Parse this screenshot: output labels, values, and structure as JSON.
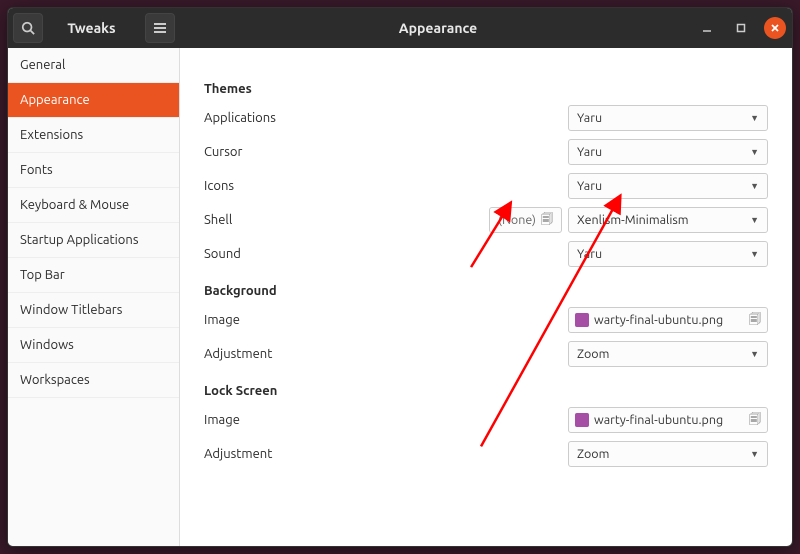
{
  "titlebar": {
    "app_name": "Tweaks",
    "page_title": "Appearance"
  },
  "sidebar": {
    "items": [
      {
        "label": "General"
      },
      {
        "label": "Appearance"
      },
      {
        "label": "Extensions"
      },
      {
        "label": "Fonts"
      },
      {
        "label": "Keyboard & Mouse"
      },
      {
        "label": "Startup Applications"
      },
      {
        "label": "Top Bar"
      },
      {
        "label": "Window Titlebars"
      },
      {
        "label": "Windows"
      },
      {
        "label": "Workspaces"
      }
    ],
    "active_index": 1
  },
  "sections": {
    "themes": {
      "title": "Themes",
      "rows": {
        "applications": {
          "label": "Applications",
          "value": "Yaru"
        },
        "cursor": {
          "label": "Cursor",
          "value": "Yaru"
        },
        "icons": {
          "label": "Icons",
          "value": "Yaru"
        },
        "shell": {
          "label": "Shell",
          "value": "Xenlism-Minimalism",
          "none_label": "(None)"
        },
        "sound": {
          "label": "Sound",
          "value": "Yaru"
        }
      }
    },
    "background": {
      "title": "Background",
      "image": {
        "label": "Image",
        "filename": "warty-final-ubuntu.png"
      },
      "adjustment": {
        "label": "Adjustment",
        "value": "Zoom"
      }
    },
    "lockscreen": {
      "title": "Lock Screen",
      "image": {
        "label": "Image",
        "filename": "warty-final-ubuntu.png"
      },
      "adjustment": {
        "label": "Adjustment",
        "value": "Zoom"
      }
    }
  }
}
